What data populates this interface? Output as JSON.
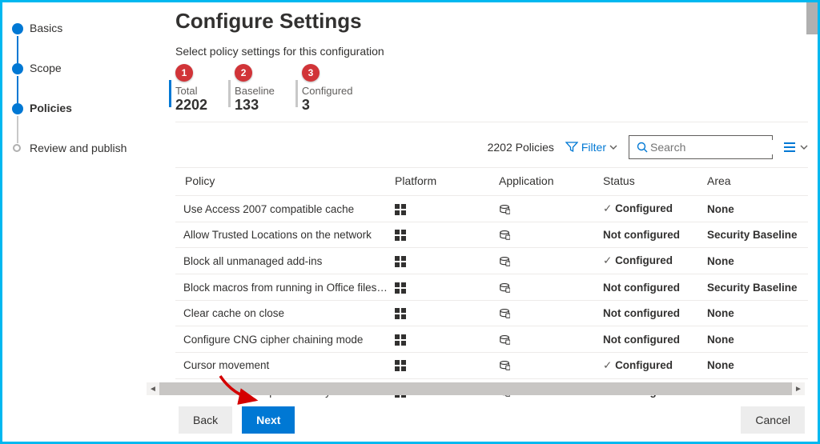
{
  "sidebar": {
    "steps": [
      {
        "label": "Basics",
        "done": true,
        "active": false
      },
      {
        "label": "Scope",
        "done": true,
        "active": false
      },
      {
        "label": "Policies",
        "done": true,
        "active": true
      },
      {
        "label": "Review and publish",
        "done": false,
        "active": false
      }
    ]
  },
  "header": {
    "title": "Configure Settings",
    "subtitle": "Select policy settings for this configuration"
  },
  "metrics": [
    {
      "badge": "1",
      "label": "Total",
      "value": "2202"
    },
    {
      "badge": "2",
      "label": "Baseline",
      "value": "133"
    },
    {
      "badge": "3",
      "label": "Configured",
      "value": "3"
    }
  ],
  "toolbar": {
    "count_label": "2202 Policies",
    "filter_label": "Filter",
    "search_placeholder": "Search"
  },
  "table": {
    "columns": [
      "Policy",
      "Platform",
      "Application",
      "Status",
      "Area"
    ],
    "rows": [
      {
        "policy": "Use Access 2007 compatible cache",
        "status": "Configured",
        "area": "None"
      },
      {
        "policy": "Allow Trusted Locations on the network",
        "status": "Not configured",
        "area": "Security Baseline"
      },
      {
        "policy": "Block all unmanaged add-ins",
        "status": "Configured",
        "area": "None"
      },
      {
        "policy": "Block macros from running in Office files fr…",
        "status": "Not configured",
        "area": "Security Baseline"
      },
      {
        "policy": "Clear cache on close",
        "status": "Not configured",
        "area": "None"
      },
      {
        "policy": "Configure CNG cipher chaining mode",
        "status": "Not configured",
        "area": "None"
      },
      {
        "policy": "Cursor movement",
        "status": "Configured",
        "area": "None"
      },
      {
        "policy": "Show custom templates tab by default in A…",
        "status": "Not configured",
        "area": "None"
      }
    ]
  },
  "footer": {
    "back": "Back",
    "next": "Next",
    "cancel": "Cancel"
  }
}
